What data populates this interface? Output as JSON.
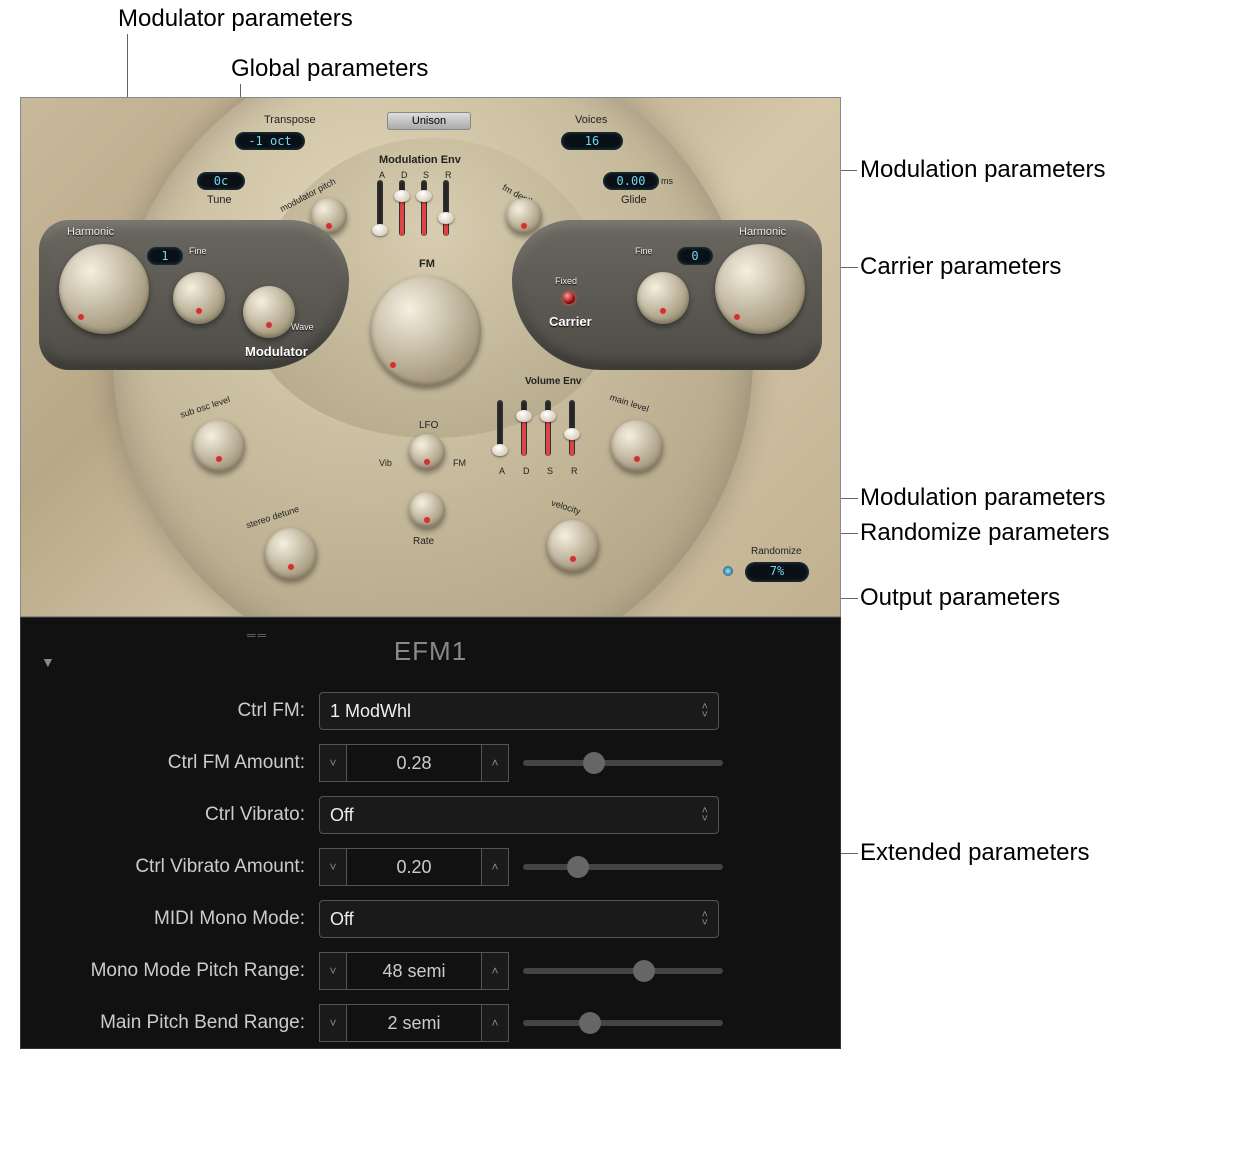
{
  "callouts": {
    "modulator": "Modulator parameters",
    "global": "Global parameters",
    "modulation1": "Modulation parameters",
    "carrier": "Carrier parameters",
    "modulation2": "Modulation parameters",
    "randomize": "Randomize parameters",
    "output": "Output parameters",
    "extended": "Extended parameters"
  },
  "global": {
    "transpose_label": "Transpose",
    "transpose_value": "-1 oct",
    "tune_label": "Tune",
    "tune_value": "0c",
    "unison_label": "Unison",
    "voices_label": "Voices",
    "voices_value": "16",
    "glide_label": "Glide",
    "glide_value": "0.00",
    "glide_unit": "ms"
  },
  "modulation": {
    "env_title": "Modulation Env",
    "mod_pitch_label": "modulator pitch",
    "fm_depth_label": "fm depth",
    "adsr": [
      "A",
      "D",
      "S",
      "R"
    ],
    "fm_knob_label": "FM",
    "lfo_label": "LFO",
    "vib_label": "Vib",
    "lfo_fm_label": "FM",
    "rate_label": "Rate"
  },
  "modulator": {
    "section": "Modulator",
    "harmonic_label": "Harmonic",
    "harmonic_value": "1",
    "fine_label": "Fine",
    "wave_label": "Wave"
  },
  "carrier": {
    "section": "Carrier",
    "harmonic_label": "Harmonic",
    "harmonic_value": "0",
    "fine_label": "Fine",
    "fixed_label": "Fixed"
  },
  "output": {
    "sub_osc_label": "sub osc level",
    "stereo_detune_label": "stereo detune",
    "vol_env_title": "Volume Env",
    "adsr": [
      "A",
      "D",
      "S",
      "R"
    ],
    "main_level_label": "main level",
    "velocity_label": "velocity"
  },
  "randomize": {
    "label": "Randomize",
    "value": "7%"
  },
  "extended": {
    "title": "EFM1",
    "ctrl_fm": {
      "label": "Ctrl FM:",
      "value": "1 ModWhl"
    },
    "ctrl_fm_amount": {
      "label": "Ctrl FM Amount:",
      "value": "0.28",
      "pct": 30
    },
    "ctrl_vibrato": {
      "label": "Ctrl Vibrato:",
      "value": "Off"
    },
    "ctrl_vibrato_amount": {
      "label": "Ctrl Vibrato Amount:",
      "value": "0.20",
      "pct": 22
    },
    "midi_mono": {
      "label": "MIDI Mono Mode:",
      "value": "Off"
    },
    "mono_pitch_range": {
      "label": "Mono Mode Pitch Range:",
      "value": "48 semi",
      "pct": 55
    },
    "main_pitch_bend": {
      "label": "Main Pitch Bend Range:",
      "value": "2 semi",
      "pct": 28
    }
  }
}
